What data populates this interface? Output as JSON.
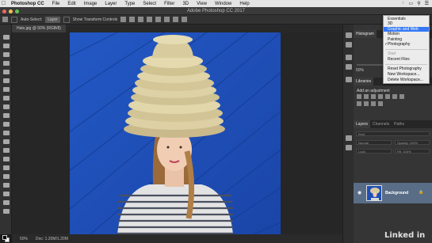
{
  "menubar": {
    "app_name": "Photoshop CC",
    "items": [
      "File",
      "Edit",
      "Image",
      "Layer",
      "Type",
      "Select",
      "Filter",
      "3D",
      "View",
      "Window",
      "Help"
    ]
  },
  "window": {
    "title": "Adobe Photoshop CC 2017"
  },
  "options": {
    "auto_select_label": "Auto-Select:",
    "auto_select_value": "Layer",
    "transform_label": "Show Transform Controls"
  },
  "document": {
    "tab_label": "Hats.jpg @ 50% (RGB/8)",
    "zoom": "50%",
    "doc_info": "Doc: 1.20M/1.20M"
  },
  "panels": {
    "histogram_tab": "Histogram",
    "libraries_tab": "Libraries",
    "zoom_value": "50%",
    "adjustments_title": "Add an adjustment",
    "layers_tabs": [
      "Layers",
      "Channels",
      "Paths"
    ],
    "filter_kind": "Kind",
    "blend_mode": "Normal",
    "opacity": "Opacity: 100%",
    "lock_label": "Lock:",
    "fill": "Fill: 100%",
    "layer_name": "Background"
  },
  "workspace_menu": {
    "items": [
      "Essentials",
      "3D",
      "Graphic and Web",
      "Motion",
      "Painting",
      "Photography"
    ],
    "start": "Start",
    "recent": "Recent Files",
    "actions": [
      "Reset Photography",
      "New Workspace...",
      "Delete Workspace..."
    ],
    "highlighted": "Graphic and Web",
    "checked": "Photography",
    "highlight_color": "#3478f6"
  },
  "watermark": "Linked in",
  "colors": {
    "photo_bg": "#1f4fb5",
    "panel": "#353535",
    "layer_selected": "#5a6d86"
  }
}
